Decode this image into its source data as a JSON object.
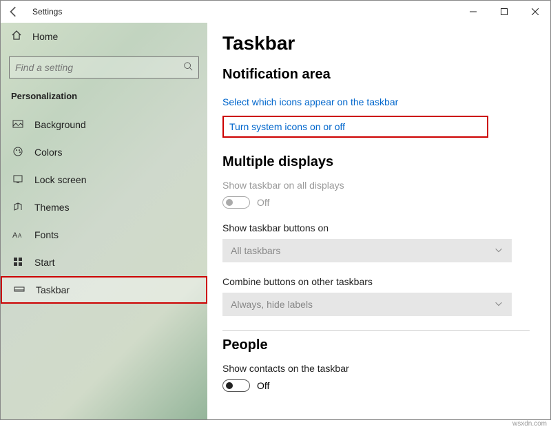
{
  "window": {
    "title": "Settings"
  },
  "sidebar": {
    "home": "Home",
    "search_placeholder": "Find a setting",
    "section": "Personalization",
    "items": [
      {
        "label": "Background"
      },
      {
        "label": "Colors"
      },
      {
        "label": "Lock screen"
      },
      {
        "label": "Themes"
      },
      {
        "label": "Fonts"
      },
      {
        "label": "Start"
      },
      {
        "label": "Taskbar"
      }
    ]
  },
  "main": {
    "title": "Taskbar",
    "notification": {
      "heading": "Notification area",
      "link1": "Select which icons appear on the taskbar",
      "link2": "Turn system icons on or off"
    },
    "displays": {
      "heading": "Multiple displays",
      "show_all": {
        "label": "Show taskbar on all displays",
        "state": "Off"
      },
      "buttons_on": {
        "label": "Show taskbar buttons on",
        "value": "All taskbars"
      },
      "combine": {
        "label": "Combine buttons on other taskbars",
        "value": "Always, hide labels"
      }
    },
    "people": {
      "heading": "People",
      "show_contacts": {
        "label": "Show contacts on the taskbar",
        "state": "Off"
      }
    }
  },
  "watermark": "wsxdn.com"
}
